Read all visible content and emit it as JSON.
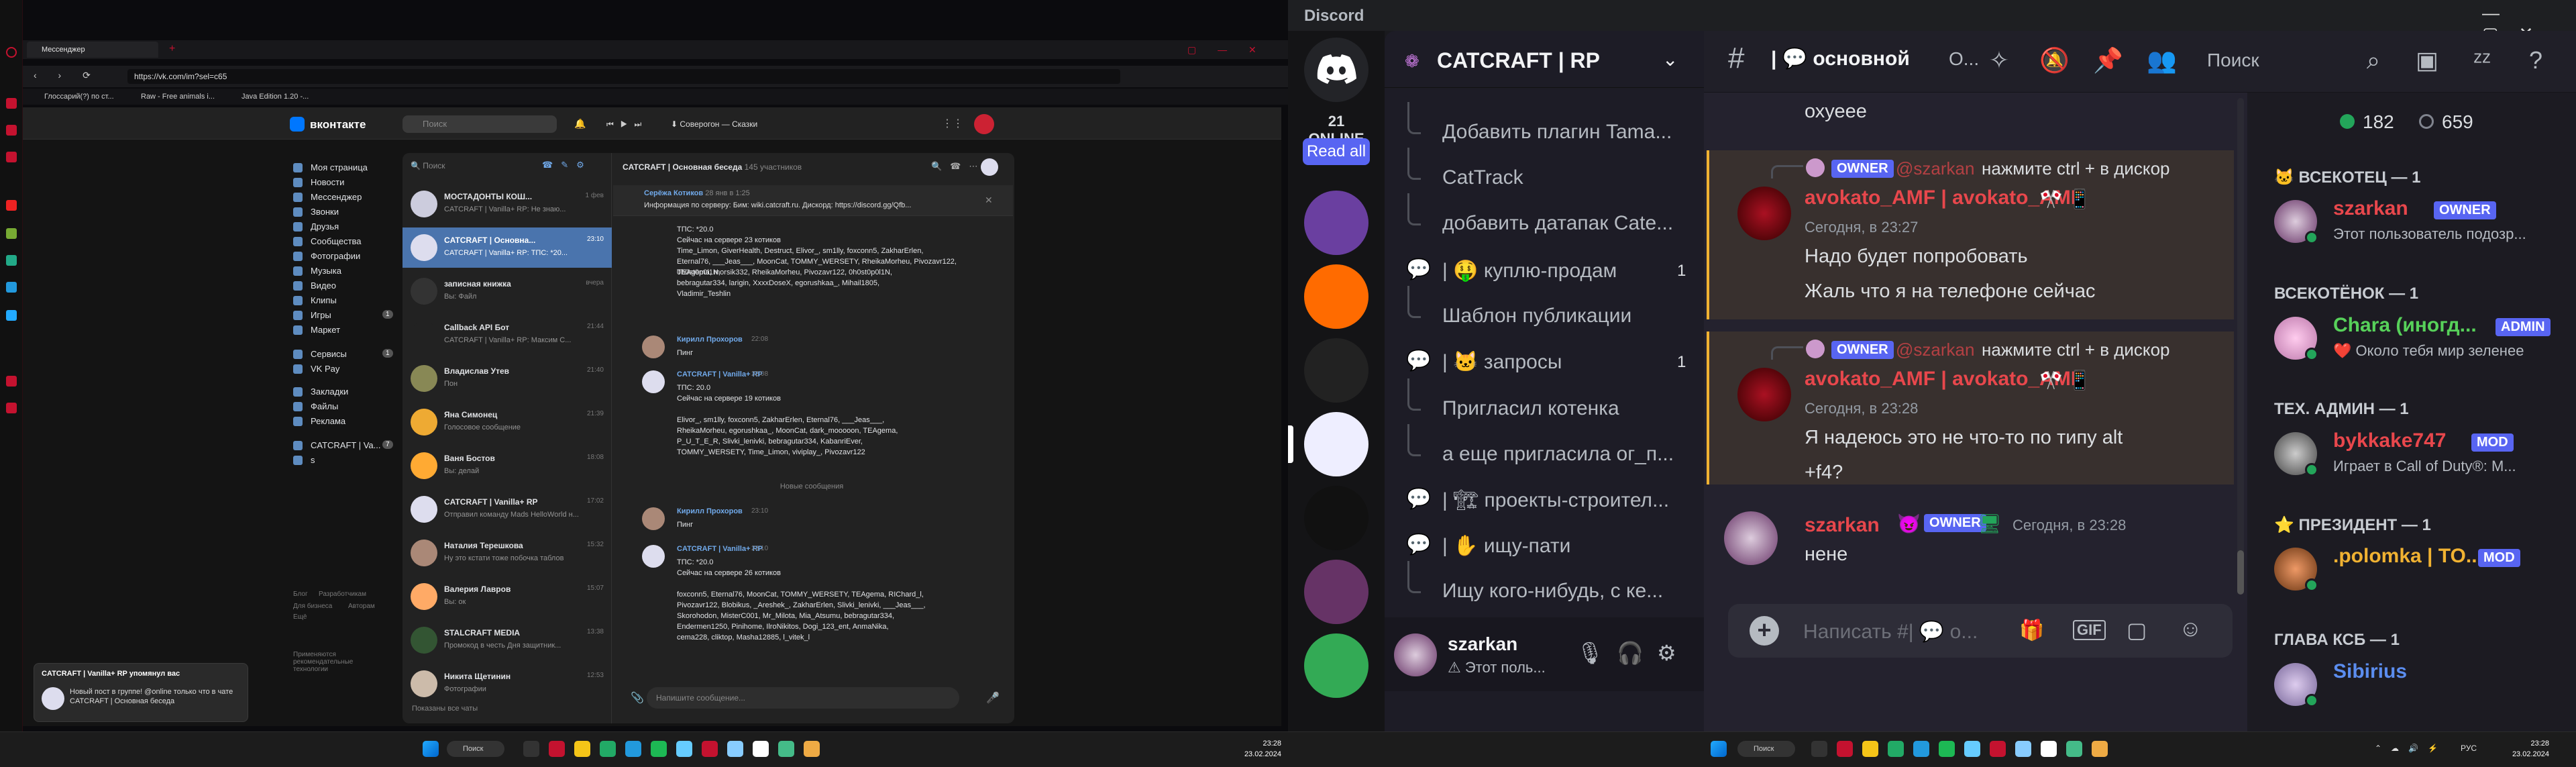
{
  "opera": {
    "tabs": [
      {
        "label": "Мессенджер"
      }
    ],
    "url": "https://vk.com/im?sel=c65",
    "bookmarks": [
      "Глоссарий(?) по ст...",
      "Raw - Free animals i...",
      "Java Edition 1.20 -..."
    ]
  },
  "vk": {
    "logo": "вконтакте",
    "search_placeholder": "Поиск",
    "player": "Соверогон — Сказки",
    "nav": [
      "Моя страница",
      "Новости",
      "Мессенджер",
      "Звонки",
      "Друзья",
      "Сообщества",
      "Фотографии",
      "Музыка",
      "Видео",
      "Клипы",
      "Игры",
      "Маркет",
      "Сервисы",
      "VK Pay",
      "Закладки",
      "Файлы",
      "Реклама",
      "CATCRAFT | Va...",
      "s"
    ],
    "nav_badges": {
      "Игры": "1",
      "Сервисы": "1",
      "CATCRAFT | Va...": "7"
    },
    "footer": [
      "Блог",
      "Разработчикам",
      "Для бизнеса",
      "Авторам",
      "Ещё",
      "Применяются рекомендательные технологии"
    ],
    "list_search": "Поиск",
    "chats": [
      {
        "name": "МОСТАДОНТЫ КОШ...",
        "preview": "CATCRAFT | Vanilla+ RP: Не знаю...",
        "time": "1 фев"
      },
      {
        "name": "CATCRAFT | Основна...",
        "preview": "CATCRAFT | Vanilla+ RP: ТПС: *20...",
        "time": "23:10"
      },
      {
        "name": "записная книжка",
        "preview": "Вы: Файл",
        "time": "вчера"
      },
      {
        "name": "Callback API Бот",
        "preview": "CATCRAFT | Vanilla+ RP: Максим С...",
        "time": "21:44"
      },
      {
        "name": "Владислав Утев",
        "preview": "Пон",
        "time": "21:40"
      },
      {
        "name": "Яна Симонец",
        "preview": "Голосовое сообщение",
        "time": "21:39"
      },
      {
        "name": "Ваня Бостов",
        "preview": "Вы: делай",
        "time": "18:08"
      },
      {
        "name": "CATCRAFT | Vanilla+ RP",
        "preview": "Отправил команду Mads HelloWorld н...",
        "time": "17:02"
      },
      {
        "name": "Наталия Терешкова",
        "preview": "Ну это кстати тоже побочка таблов",
        "time": "15:32"
      },
      {
        "name": "Валерия Лавров",
        "preview": "Вы: ок",
        "time": "15:07"
      },
      {
        "name": "STALCRAFT MEDIA",
        "preview": "Промокод в честь Дня защитник...",
        "time": "13:38"
      },
      {
        "name": "Никита Щетинин",
        "preview": "Фотографии",
        "time": "12:53"
      }
    ],
    "show_all": "Показаны все чаты",
    "chat_title": "CATCRAFT | Основная беседа",
    "chat_members": "145 участников",
    "pinned_author": "Серёжа Котиков",
    "pinned_date": "28 янв в 1:25",
    "pinned_text": "Информация по серверу: Бим: wiki.catcraft.ru. Дискорд: https://discord.gg/Qfb...",
    "messages": [
      {
        "author": "",
        "time": "",
        "lines": [
          "ТПС: *20.0",
          "Сейчас на сервере 23 котиков",
          "Time_Limon, GiverHealth, Destruct, Elivor_, sm1lly, foxconn5, ZakharErlen,",
          "Eternal76, ___Jeas___, MoonCat, TOMMY_WERSETY, RheikaMorheu, Pivozavr122, 0h0st0p0l1N,",
          "TEAgema, morsik332, RheikaMorheu, Pivozavr122, 0h0st0p0l1N,",
          "bebragutar334, larigin, XxxxDoseX, egorushkaa_, Mihail1805,",
          "Vladimir_Teshlin"
        ]
      },
      {
        "author": "Кирилл Прохоров",
        "time": "22:08",
        "lines": [
          "Пинг"
        ]
      },
      {
        "author": "CATCRAFT | Vanilla+ RP",
        "time": "22:08",
        "lines": [
          "ТПС: 20.0",
          "Сейчас на сервере 19 котиков",
          "",
          "Elivor_, sm1lly, foxconn5, ZakharErlen, Eternal76, ___Jeas___,",
          "RheikaMorheu, egorushkaa_, MoonCat, dark_mooooon, TEAgema,",
          "P_U_T_E_R, Slivki_lenivki, bebragutar334, KabanriEver,",
          "TOMMY_WERSETY, Time_Limon, viviplay_, Pivozavr122"
        ]
      },
      {
        "author": "Кирилл Прохоров",
        "time": "23:10",
        "lines": [
          "Пинг"
        ]
      },
      {
        "author": "CATCRAFT | Vanilla+ RP",
        "time": "23:10",
        "lines": [
          "ТПС: *20.0",
          "Сейчас на сервере 26 котиков",
          "",
          "foxconn5, Eternal76, MoonCat, TOMMY_WERSETY, TEAgema, RIChard_l,",
          "Pivozavr122, Blobikus, _Areshek_, ZakharErlen, Slivki_lenivki, ___Jeas___,",
          "Skorohodon, MisterC001, Mr_Milota, Mia_Atsumu, bebragutar334,",
          "Endermen1250, Pinihome, IlroNikitos, Dogi_123_ent, AnmaNika,",
          "cema228, cliktop, Masha12885, l_vitek_l"
        ]
      }
    ],
    "new_msgs_divider": "Новые сообщения",
    "compose_placeholder": "Напишите сообщение...",
    "notif_title": "CATCRAFT | Vanilla+ RP упомянул вас",
    "notif_text": "Новый пост в группе! @online только что в чате CATCRAFT | Основная беседа"
  },
  "left_taskbar": {
    "search": "Поиск",
    "time": "23:28",
    "date": "23.02.2024"
  },
  "discord": {
    "app_title": "Discord",
    "online": "21 ONLINE",
    "read_all": "Read all",
    "server_name": "CATCRAFT | RP",
    "channels": [
      {
        "label": "Добавить плагин Tama...",
        "thread": true
      },
      {
        "label": "CatTrack",
        "thread": true
      },
      {
        "label": "добавить датапак Cate...",
        "thread": true
      },
      {
        "label": "| 🤑 куплю-продам",
        "thread": false,
        "count": "1"
      },
      {
        "label": "Шаблон публикации",
        "thread": true
      },
      {
        "label": "| 🐱 запросы",
        "thread": false,
        "count": "1"
      },
      {
        "label": "Пригласил котенка",
        "thread": true
      },
      {
        "label": "а еще пригласила ог_п...",
        "thread": true
      },
      {
        "label": "| 🏗 проекты-строител...",
        "thread": false
      },
      {
        "label": "| ✋ ищу-пати",
        "thread": false
      },
      {
        "label": "Ищу кого-нибудь, с ке...",
        "thread": true
      }
    ],
    "channel_title": "основной",
    "channel_short": "О...",
    "search_placeholder": "Поиск",
    "user": {
      "name": "szarkan",
      "status": "Этот поль..."
    },
    "messages": [
      {
        "type": "cont",
        "text": "охуеее"
      },
      {
        "type": "reply",
        "reply_tag": "OWNER",
        "reply_name": "@szarkan",
        "reply_text": "нажмите ctrl + в дискор",
        "author": "avokato_AMF | avokato_AMF",
        "time": "Сегодня, в 23:27",
        "lines": [
          "Надо будет попробовать",
          "Жаль что я на телефоне сейчас"
        ]
      },
      {
        "type": "reply",
        "reply_tag": "OWNER",
        "reply_name": "@szarkan",
        "reply_text": "нажмите ctrl + в дискор",
        "author": "avokato_AMF | avokato_AMF",
        "time": "Сегодня, в 23:28",
        "lines": [
          "Я надеюсь это не что-то по типу alt",
          "+f4?"
        ]
      },
      {
        "type": "msg",
        "author": "szarkan",
        "tag": "OWNER",
        "time": "Сегодня, в 23:28",
        "lines": [
          "нене"
        ]
      }
    ],
    "composer_placeholder": "Написать #| 💬 о...",
    "online_count": "182",
    "total_count": "659",
    "member_groups": [
      {
        "title": "🐱 ВСЕКОТЕЦ — 1",
        "name": "szarkan",
        "name_color": "#e8474c",
        "tag": "OWNER",
        "status": "Этот пользователь подозр..."
      },
      {
        "title": "ВСЕКОТЁНОК — 1",
        "name": "Chara (иногд...",
        "name_color": "#57d15a",
        "tag": "ADMIN",
        "status": "❤️ Около тебя мир зеленее"
      },
      {
        "title": "ТЕХ. АДМИН — 1",
        "name": "bykkake747",
        "name_color": "#e8474c",
        "tag": "MOD",
        "status": "Играет в Call of Duty®: M..."
      },
      {
        "title": "⭐ ПРЕЗИДЕНТ — 1",
        "name": ".polomka | TO...",
        "name_color": "#f0b232",
        "tag": "MOD",
        "status": ""
      },
      {
        "title": "ГЛАВА КСБ — 1",
        "name": "Sibirius",
        "name_color": "#5b8def",
        "tag": "",
        "status": ""
      }
    ]
  },
  "right_taskbar": {
    "search": "Поиск",
    "lang": "РУС",
    "time": "23:28",
    "date": "23.02.2024"
  },
  "colors": {
    "discord_red": "#e8474c",
    "blurple": "#5865f2",
    "vk_blue": "#4a74ad",
    "mention_gold": "#f0b232"
  }
}
